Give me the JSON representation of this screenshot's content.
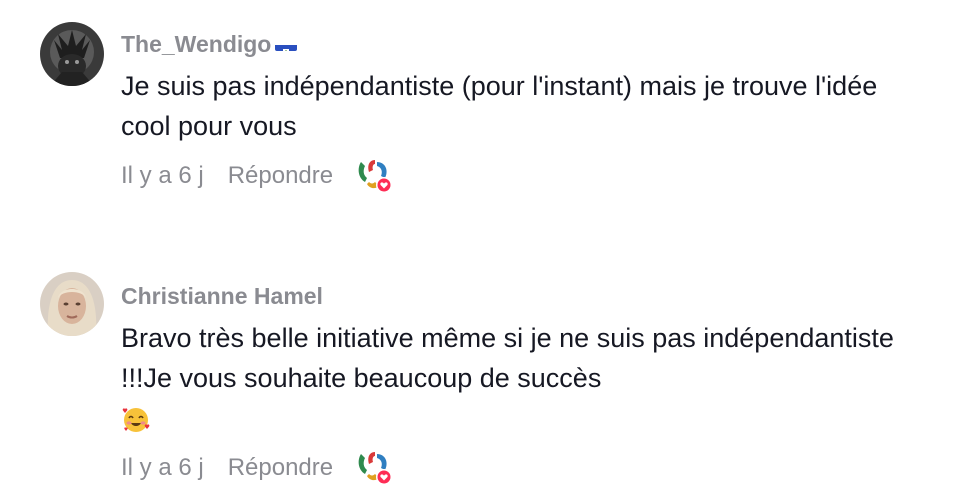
{
  "comments": [
    {
      "username": "The_Wendigo",
      "flag": "haiti-flag",
      "text": "Je suis pas indépendantiste (pour l'instant) mais je trouve l'idée cool pour vous",
      "time": "Il y a 6 j",
      "reply_label": "Répondre",
      "reaction_icon": "creator-liked-icon"
    },
    {
      "username": "Christianne Hamel",
      "text": "Bravo très belle initiative même si je ne suis pas indépendantiste !!!Je vous souhaite beaucoup de succès",
      "emoji": "smiling-face-with-hearts",
      "time": "Il y a 6 j",
      "reply_label": "Répondre",
      "reaction_icon": "creator-liked-icon"
    }
  ],
  "colors": {
    "text": "#161823",
    "muted": "#8a8b91",
    "heart": "#fe2c55"
  }
}
